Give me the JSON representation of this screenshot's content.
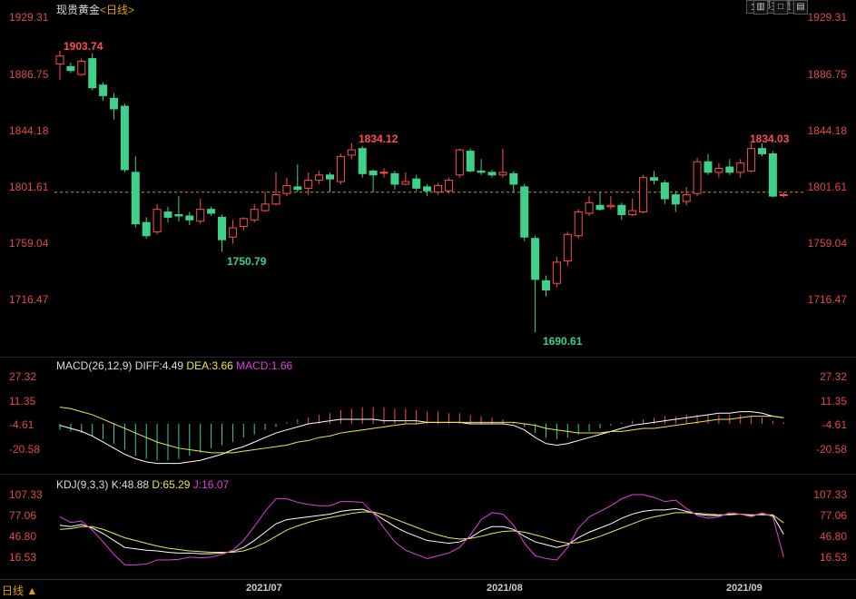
{
  "header": {
    "instrument": "现贵黄金",
    "period": "<日线>",
    "theme_button": "全部主题",
    "theme_arrow": "▼",
    "win_buttons": [
      "▥",
      "□",
      "▤"
    ]
  },
  "price_axis": {
    "labels": [
      "1929.31",
      "1886.75",
      "1844.18",
      "1801.61",
      "1759.04",
      "1716.47"
    ],
    "values": [
      1929.31,
      1886.75,
      1844.18,
      1801.61,
      1759.04,
      1716.47
    ]
  },
  "annotations": {
    "high1": "1903.74",
    "low1": "1750.79",
    "high2": "1834.12",
    "low2": "1690.61",
    "high3": "1834.03"
  },
  "macd": {
    "title": "MACD(26,12,9)",
    "diff": "DIFF:4.49",
    "dea": "DEA:3.66",
    "macd": "MACD:1.66",
    "axis": [
      "27.32",
      "11.35",
      "-4.61",
      "-20.58"
    ]
  },
  "kdj": {
    "title": "KDJ(9,3,3)",
    "k": "K:48.88",
    "d": "D:65.29",
    "j": "J:16.07",
    "axis": [
      "107.33",
      "77.06",
      "46.80",
      "16.53"
    ]
  },
  "footer": {
    "period_button": "日线 ▲",
    "dates": [
      "2021/07",
      "2021/08",
      "2021/09"
    ]
  },
  "chart_data": {
    "type": "candlestick",
    "reference_price": 1797.0,
    "candles": [
      {
        "o": 1894,
        "c": 1900,
        "h": 1904,
        "l": 1882
      },
      {
        "o": 1892,
        "c": 1889,
        "h": 1895,
        "l": 1887
      },
      {
        "o": 1886,
        "c": 1896,
        "h": 1898,
        "l": 1885
      },
      {
        "o": 1898,
        "c": 1876,
        "h": 1902,
        "l": 1874
      },
      {
        "o": 1878,
        "c": 1870,
        "h": 1880,
        "l": 1866
      },
      {
        "o": 1868,
        "c": 1860,
        "h": 1872,
        "l": 1852
      },
      {
        "o": 1862,
        "c": 1814,
        "h": 1864,
        "l": 1812
      },
      {
        "o": 1812,
        "c": 1773,
        "h": 1824,
        "l": 1770
      },
      {
        "o": 1774,
        "c": 1764,
        "h": 1778,
        "l": 1762
      },
      {
        "o": 1767,
        "c": 1784,
        "h": 1788,
        "l": 1765
      },
      {
        "o": 1782,
        "c": 1778,
        "h": 1786,
        "l": 1774
      },
      {
        "o": 1780,
        "c": 1779,
        "h": 1794,
        "l": 1775
      },
      {
        "o": 1779,
        "c": 1776,
        "h": 1782,
        "l": 1772
      },
      {
        "o": 1775,
        "c": 1784,
        "h": 1792,
        "l": 1773
      },
      {
        "o": 1784,
        "c": 1781,
        "h": 1786,
        "l": 1779
      },
      {
        "o": 1778,
        "c": 1761,
        "h": 1780,
        "l": 1752
      },
      {
        "o": 1763,
        "c": 1770,
        "h": 1776,
        "l": 1758
      },
      {
        "o": 1771,
        "c": 1777,
        "h": 1778,
        "l": 1768
      },
      {
        "o": 1776,
        "c": 1784,
        "h": 1788,
        "l": 1774
      },
      {
        "o": 1783,
        "c": 1788,
        "h": 1797,
        "l": 1782
      },
      {
        "o": 1788,
        "c": 1795,
        "h": 1812,
        "l": 1787
      },
      {
        "o": 1796,
        "c": 1802,
        "h": 1808,
        "l": 1794
      },
      {
        "o": 1801,
        "c": 1799,
        "h": 1818,
        "l": 1797
      },
      {
        "o": 1800,
        "c": 1806,
        "h": 1812,
        "l": 1795
      },
      {
        "o": 1806,
        "c": 1810,
        "h": 1813,
        "l": 1803
      },
      {
        "o": 1810,
        "c": 1807,
        "h": 1812,
        "l": 1797
      },
      {
        "o": 1805,
        "c": 1824,
        "h": 1826,
        "l": 1803
      },
      {
        "o": 1825,
        "c": 1829,
        "h": 1834,
        "l": 1822
      },
      {
        "o": 1830,
        "c": 1811,
        "h": 1832,
        "l": 1808
      },
      {
        "o": 1813,
        "c": 1810,
        "h": 1814,
        "l": 1797
      },
      {
        "o": 1812,
        "c": 1812,
        "h": 1815,
        "l": 1808
      },
      {
        "o": 1811,
        "c": 1803,
        "h": 1813,
        "l": 1799
      },
      {
        "o": 1803,
        "c": 1805,
        "h": 1812,
        "l": 1802
      },
      {
        "o": 1807,
        "c": 1800,
        "h": 1810,
        "l": 1798
      },
      {
        "o": 1801,
        "c": 1798,
        "h": 1803,
        "l": 1794
      },
      {
        "o": 1797,
        "c": 1802,
        "h": 1804,
        "l": 1795
      },
      {
        "o": 1798,
        "c": 1806,
        "h": 1808,
        "l": 1796
      },
      {
        "o": 1810,
        "c": 1829,
        "h": 1830,
        "l": 1808
      },
      {
        "o": 1828,
        "c": 1813,
        "h": 1830,
        "l": 1812
      },
      {
        "o": 1813,
        "c": 1812,
        "h": 1822,
        "l": 1810
      },
      {
        "o": 1812,
        "c": 1810,
        "h": 1814,
        "l": 1808
      },
      {
        "o": 1810,
        "c": 1812,
        "h": 1830,
        "l": 1808
      },
      {
        "o": 1811,
        "c": 1803,
        "h": 1813,
        "l": 1797
      },
      {
        "o": 1801,
        "c": 1763,
        "h": 1803,
        "l": 1760
      },
      {
        "o": 1762,
        "c": 1731,
        "h": 1764,
        "l": 1691
      },
      {
        "o": 1730,
        "c": 1723,
        "h": 1734,
        "l": 1718
      },
      {
        "o": 1728,
        "c": 1744,
        "h": 1748,
        "l": 1725
      },
      {
        "o": 1745,
        "c": 1765,
        "h": 1767,
        "l": 1741
      },
      {
        "o": 1764,
        "c": 1782,
        "h": 1784,
        "l": 1762
      },
      {
        "o": 1781,
        "c": 1789,
        "h": 1794,
        "l": 1779
      },
      {
        "o": 1787,
        "c": 1784,
        "h": 1797,
        "l": 1783
      },
      {
        "o": 1786,
        "c": 1787,
        "h": 1794,
        "l": 1784
      },
      {
        "o": 1787,
        "c": 1780,
        "h": 1789,
        "l": 1776
      },
      {
        "o": 1780,
        "c": 1783,
        "h": 1792,
        "l": 1779
      },
      {
        "o": 1782,
        "c": 1808,
        "h": 1810,
        "l": 1781
      },
      {
        "o": 1808,
        "c": 1806,
        "h": 1813,
        "l": 1803
      },
      {
        "o": 1804,
        "c": 1792,
        "h": 1806,
        "l": 1788
      },
      {
        "o": 1795,
        "c": 1788,
        "h": 1798,
        "l": 1782
      },
      {
        "o": 1790,
        "c": 1795,
        "h": 1801,
        "l": 1787
      },
      {
        "o": 1796,
        "c": 1820,
        "h": 1823,
        "l": 1794
      },
      {
        "o": 1820,
        "c": 1812,
        "h": 1826,
        "l": 1810
      },
      {
        "o": 1812,
        "c": 1815,
        "h": 1819,
        "l": 1808
      },
      {
        "o": 1816,
        "c": 1812,
        "h": 1822,
        "l": 1810
      },
      {
        "o": 1812,
        "c": 1819,
        "h": 1822,
        "l": 1808
      },
      {
        "o": 1813,
        "c": 1830,
        "h": 1834,
        "l": 1812
      },
      {
        "o": 1830,
        "c": 1826,
        "h": 1834,
        "l": 1824
      },
      {
        "o": 1826,
        "c": 1794,
        "h": 1828,
        "l": 1793
      },
      {
        "o": 1795,
        "c": 1795,
        "h": 1797,
        "l": 1793
      }
    ],
    "macd_hist": [
      -4,
      -5,
      -6,
      -8,
      -10,
      -13,
      -17,
      -21,
      -23,
      -24,
      -24,
      -23,
      -21,
      -19,
      -16,
      -14,
      -12,
      -9,
      -7,
      -4,
      -2,
      1,
      3,
      4,
      6,
      7,
      9,
      10,
      11,
      11,
      11,
      10,
      10,
      9,
      8,
      8,
      7,
      7,
      6,
      5,
      4,
      3,
      1,
      -2,
      -6,
      -9,
      -10,
      -9,
      -7,
      -5,
      -3,
      -1,
      1,
      2,
      3,
      4,
      5,
      5,
      6,
      6,
      6,
      6,
      6,
      6,
      5,
      4,
      2,
      1
    ],
    "macd_diff": [
      -1,
      -3,
      -5,
      -8,
      -12,
      -16,
      -20,
      -23,
      -25,
      -26,
      -26,
      -26,
      -25,
      -24,
      -22,
      -20,
      -17,
      -15,
      -12,
      -9,
      -6,
      -4,
      -2,
      0,
      1,
      2,
      3,
      3,
      3,
      3,
      2,
      2,
      2,
      2,
      1,
      1,
      1,
      1,
      0,
      0,
      0,
      0,
      -1,
      -4,
      -9,
      -13,
      -14,
      -13,
      -11,
      -9,
      -7,
      -5,
      -3,
      -1,
      0,
      1,
      2,
      3,
      4,
      5,
      6,
      7,
      7,
      8,
      8,
      7,
      5,
      4
    ],
    "macd_dea": [
      11,
      10,
      8,
      6,
      3,
      0,
      -3,
      -6,
      -9,
      -12,
      -14,
      -16,
      -17,
      -18,
      -19,
      -19,
      -19,
      -18,
      -17,
      -16,
      -15,
      -14,
      -12,
      -11,
      -9,
      -8,
      -6,
      -5,
      -4,
      -3,
      -2,
      -1,
      0,
      0,
      1,
      1,
      1,
      1,
      1,
      1,
      1,
      1,
      1,
      0,
      -1,
      -3,
      -4,
      -5,
      -6,
      -6,
      -6,
      -5,
      -5,
      -4,
      -3,
      -3,
      -2,
      -1,
      0,
      1,
      2,
      3,
      3,
      4,
      5,
      5,
      5,
      4
    ],
    "kdj_k": [
      62,
      60,
      63,
      58,
      50,
      40,
      30,
      28,
      26,
      25,
      23,
      22,
      22,
      21,
      21,
      22,
      24,
      30,
      40,
      52,
      64,
      70,
      72,
      74,
      76,
      78,
      82,
      84,
      85,
      80,
      70,
      60,
      52,
      46,
      40,
      38,
      36,
      38,
      44,
      54,
      60,
      60,
      56,
      46,
      38,
      34,
      30,
      34,
      44,
      52,
      58,
      64,
      72,
      78,
      82,
      84,
      84,
      86,
      82,
      78,
      76,
      76,
      78,
      78,
      76,
      78,
      76,
      48.88
    ],
    "kdj_d": [
      56,
      57,
      60,
      60,
      56,
      50,
      44,
      40,
      36,
      32,
      29,
      27,
      25,
      24,
      23,
      23,
      23,
      25,
      30,
      37,
      46,
      55,
      61,
      66,
      70,
      73,
      76,
      79,
      81,
      81,
      77,
      71,
      65,
      59,
      53,
      48,
      44,
      42,
      43,
      46,
      50,
      53,
      54,
      52,
      48,
      44,
      39,
      36,
      37,
      41,
      46,
      52,
      58,
      64,
      70,
      74,
      77,
      80,
      80,
      79,
      78,
      77,
      77,
      78,
      77,
      77,
      77,
      65.29
    ],
    "kdj_j": [
      74,
      66,
      68,
      55,
      38,
      20,
      5,
      5,
      6,
      12,
      12,
      13,
      16,
      15,
      16,
      20,
      26,
      40,
      60,
      82,
      100,
      100,
      95,
      92,
      90,
      90,
      96,
      96,
      95,
      80,
      58,
      38,
      26,
      20,
      14,
      18,
      22,
      30,
      48,
      70,
      80,
      78,
      62,
      36,
      18,
      14,
      12,
      30,
      58,
      74,
      82,
      90,
      100,
      106,
      106,
      102,
      96,
      98,
      86,
      76,
      72,
      74,
      80,
      78,
      74,
      80,
      74,
      16.07
    ]
  }
}
